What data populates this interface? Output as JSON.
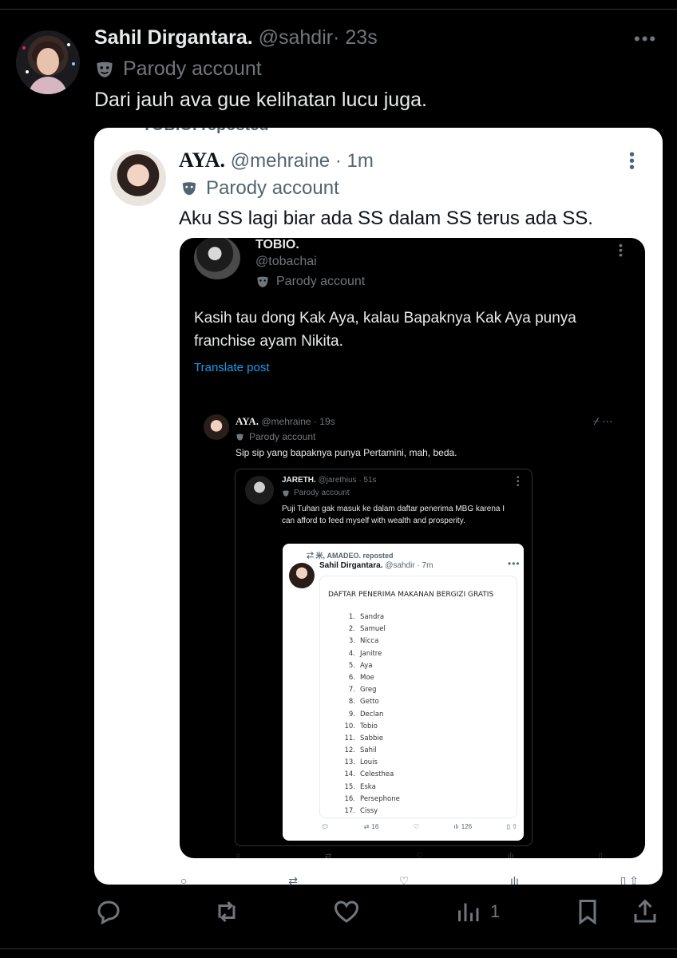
{
  "main_tweet": {
    "display_name": "Sahil Dirgantara.",
    "handle": "@sahdir",
    "time": "· 23s",
    "parody_label": "Parody account",
    "text": "Dari jauh ava gue kelihatan lucu juga.",
    "more": "•••"
  },
  "quoted": {
    "cut_header": "TOBIO. reposted",
    "display_name": "AYA.",
    "handle": "@mehraine",
    "time": "· 1m",
    "parody_label": "Parody account",
    "text": "Aku SS lagi biar ada SS dalam SS terus ada SS.",
    "inner": {
      "display_name": "TOBIO.",
      "handle": "@tobachai",
      "parody_label": "Parody account",
      "text": "Kasih tau dong Kak Aya, kalau Bapaknya Kak Aya punya franchise ayam Nikita.",
      "translate": "Translate post",
      "reply": {
        "display_name": "AYA.",
        "handle": "@mehraine",
        "time": "· 19s",
        "parody_label": "Parody account",
        "text": "Sip sip yang bapaknya punya Pertamini, mah, beda.",
        "icons": "⌿ ···",
        "quote": {
          "display_name": "JARETH.",
          "handle": "@jarethius",
          "time": "· 51s",
          "parody_label": "Parody account",
          "text": "Puji Tuhan gak masuk ke dalam daftar penerima MBG karena I can afford to feed myself with wealth and prosperity.",
          "nested": {
            "repost_label": "⇄ 米, AMADEO. reposted",
            "display_name": "Sahil Dirgantara.",
            "handle": "@sahdir",
            "time": "· 7m",
            "more": "•••",
            "list_title": "DAFTAR PENERIMA MAKANAN BERGIZI GRATIS",
            "list": [
              {
                "n": "1.",
                "name": "Sandra"
              },
              {
                "n": "2.",
                "name": "Samuel"
              },
              {
                "n": "3.",
                "name": "Nicca"
              },
              {
                "n": "4.",
                "name": "Janitre"
              },
              {
                "n": "5.",
                "name": "Aya"
              },
              {
                "n": "6.",
                "name": "Moe"
              },
              {
                "n": "7.",
                "name": "Greg"
              },
              {
                "n": "8.",
                "name": "Getto"
              },
              {
                "n": "9.",
                "name": "Declan"
              },
              {
                "n": "10.",
                "name": "Tobio"
              },
              {
                "n": "11.",
                "name": "Sabbie"
              },
              {
                "n": "12.",
                "name": "Sahil"
              },
              {
                "n": "13.",
                "name": "Louis"
              },
              {
                "n": "14.",
                "name": "Celesthea"
              },
              {
                "n": "15.",
                "name": "Eska"
              },
              {
                "n": "16.",
                "name": "Persephone"
              },
              {
                "n": "17.",
                "name": "Cissy"
              }
            ],
            "retweets": "16",
            "views": "126"
          }
        }
      }
    }
  },
  "actions": {
    "views": "1"
  }
}
